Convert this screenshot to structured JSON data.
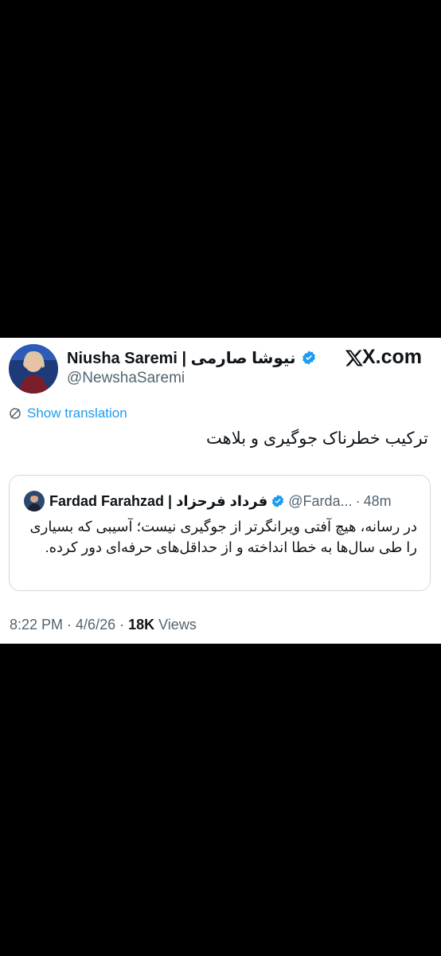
{
  "site_label": "X.com",
  "tweet": {
    "author_name": "Niusha Saremi | نیوشا صارمی",
    "handle": "@NewshaSaremi",
    "show_translation": "Show translation",
    "text": "ترکیب خطرناک جوگیری و بلاهت",
    "time": "8:22 PM",
    "date": "4/6/26",
    "views_count": "18K",
    "views_label": "Views",
    "separator": "·"
  },
  "quoted": {
    "author_name": "Fardad Farahzad | فرداد فرحزاد",
    "handle": "@Farda...",
    "separator": "·",
    "time_ago": "48m",
    "text": "در رسانه، هیچ آفتی ویرانگرتر از جوگیری نیست؛ آسیبی که بسیاری را طی سال‌ها به خطا انداخته و از حداقل‌های حرفه‌ای دور کرده."
  },
  "colors": {
    "verified_blue": "#1d9bf0",
    "text_dark": "#0f1419",
    "text_muted": "#536471",
    "border": "#cfd9de"
  },
  "icons": [
    "verified-badge-icon",
    "translate-icon",
    "x-logo-icon"
  ]
}
